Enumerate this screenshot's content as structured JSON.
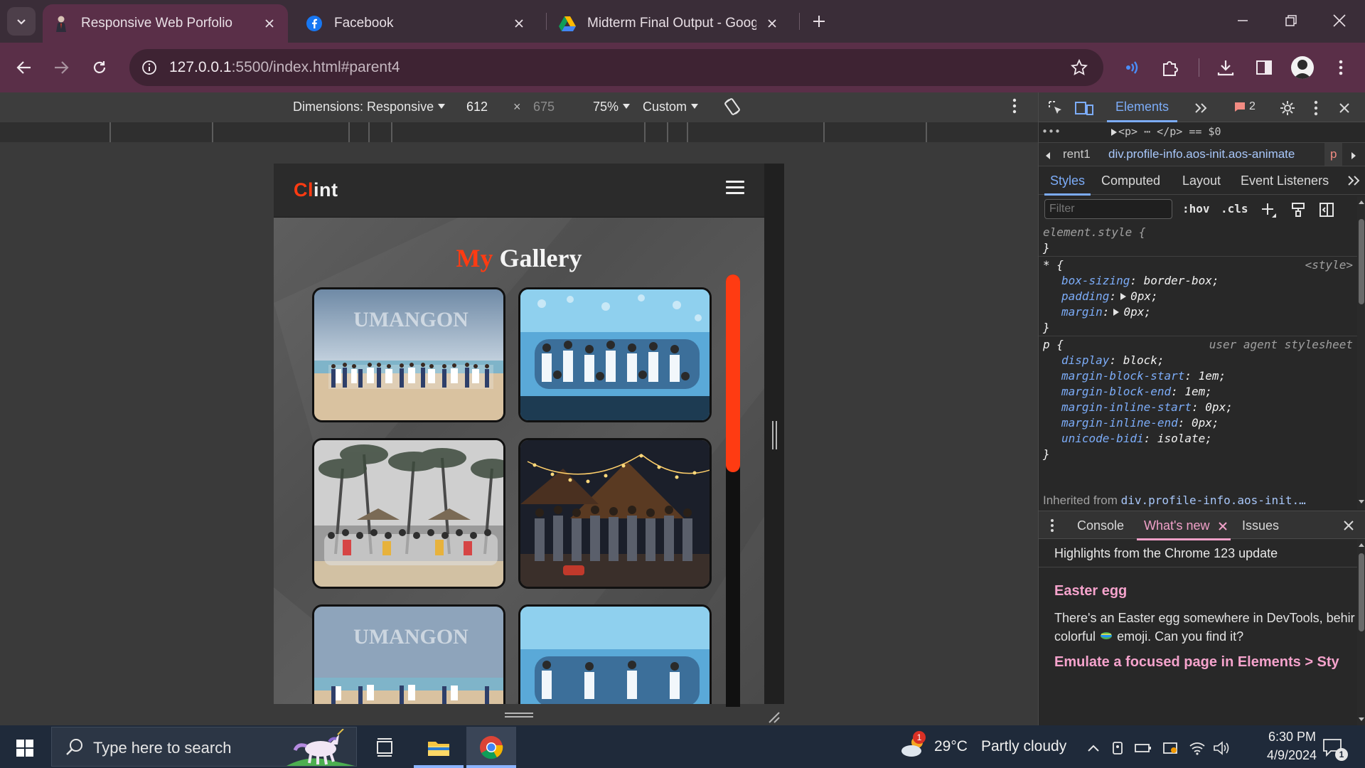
{
  "browser": {
    "tabs": [
      {
        "title": "Responsive Web Porfolio",
        "active": true
      },
      {
        "title": "Facebook",
        "active": false
      },
      {
        "title": "Midterm Final Output - Google",
        "active": false
      }
    ],
    "url_host": "127.0.0.1",
    "url_rest": ":5500/index.html#parent4"
  },
  "device_toolbar": {
    "dimensions": "Dimensions: Responsive",
    "width": "612",
    "times": "×",
    "height": "675",
    "zoom": "75%",
    "throttle": "Custom"
  },
  "site": {
    "logo_accent": "Cl",
    "logo_rest": "int",
    "gallery_title_accent": "My",
    "gallery_title_rest": " Gallery",
    "photo_caption": "UMANGON"
  },
  "devtools": {
    "panel_tab": "Elements",
    "issues_count": "2",
    "dom_line": "<p> ⋯ </p> == $0",
    "breadcrumbs": [
      "rent1",
      "div.profile-info.aos-init.aos-animate",
      "p"
    ],
    "pane_tabs": [
      "Styles",
      "Computed",
      "Layout",
      "Event Listeners"
    ],
    "filter_placeholder": "Filter",
    "hov": ":hov",
    "cls": ".cls",
    "rules": {
      "element_style": "element.style {",
      "close": "}",
      "universal_selector": "* {",
      "universal_origin": "<style>",
      "box_sizing_name": "box-sizing",
      "box_sizing_value": "border-box;",
      "padding_name": "padding",
      "padding_value": "0px;",
      "margin_name": "margin",
      "margin_value": "0px;",
      "p_selector": "p {",
      "p_origin": "user agent stylesheet",
      "display_name": "display",
      "display_value": "block;",
      "mbs_name": "margin-block-start",
      "mbs_value": "1em;",
      "mbe_name": "margin-block-end",
      "mbe_value": "1em;",
      "mis_name": "margin-inline-start",
      "mis_value": "0px;",
      "mie_name": "margin-inline-end",
      "mie_value": "0px;",
      "ub_name": "unicode-bidi",
      "ub_value": "isolate;"
    },
    "inherited_label": "Inherited from",
    "inherited_link": "div.profile-info.aos-init.…",
    "drawer_tabs": [
      "Console",
      "What's new",
      "Issues"
    ],
    "whats_new": {
      "header": "Highlights from the Chrome 123 update",
      "h1": "Easter egg",
      "p1": "There's an Easter egg somewhere in DevTools, behir colorful",
      "p1_end": "emoji. Can you find it?",
      "h2": "Emulate a focused page in Elements > Sty"
    }
  },
  "taskbar": {
    "search_placeholder": "Type here to search",
    "weather_temp": "29°C",
    "weather_desc": "Partly cloudy",
    "weather_badge": "1",
    "time": "6:30 PM",
    "date": "4/9/2024",
    "notif_count": "1"
  },
  "colors": {
    "accent_orange": "#ff3b12",
    "devtools_blue": "#7cacf8",
    "whats_new_pink": "#f5a3cc",
    "chrome_frame": "#5a2f48"
  }
}
